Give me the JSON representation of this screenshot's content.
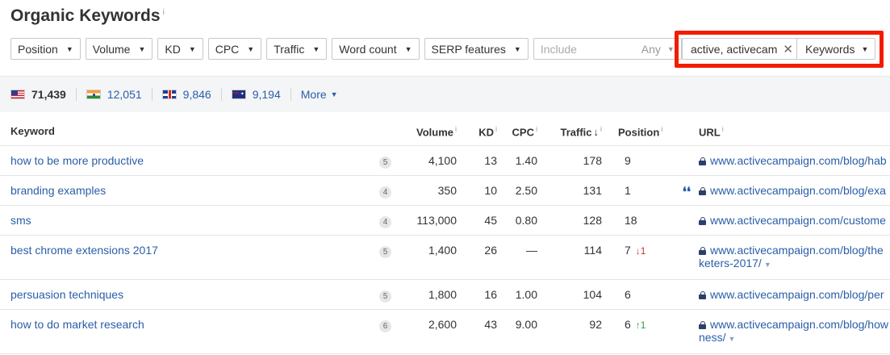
{
  "title": "Organic Keywords",
  "info_mark": "i",
  "filters": [
    {
      "label": "Position"
    },
    {
      "label": "Volume"
    },
    {
      "label": "KD"
    },
    {
      "label": "CPC"
    },
    {
      "label": "Traffic"
    },
    {
      "label": "Word count"
    },
    {
      "label": "SERP features"
    }
  ],
  "include": {
    "placeholder": "Include",
    "any_label": "Any"
  },
  "search": {
    "value": "active, activecam",
    "scope_label": "Keywords"
  },
  "countries": [
    {
      "flag": "us",
      "count": "71,439"
    },
    {
      "flag": "in",
      "count": "12,051"
    },
    {
      "flag": "gb",
      "count": "9,846"
    },
    {
      "flag": "au",
      "count": "9,194"
    }
  ],
  "more_label": "More",
  "columns": {
    "keyword": "Keyword",
    "volume": "Volume",
    "kd": "KD",
    "cpc": "CPC",
    "traffic": "Traffic",
    "position": "Position",
    "url": "URL"
  },
  "rows": [
    {
      "keyword": "how to be more productive",
      "wc": "5",
      "volume": "4,100",
      "kd": "13",
      "cpc": "1.40",
      "traffic": "178",
      "position": "9",
      "change": "",
      "change_dir": "",
      "serp": "",
      "url": "www.activecampaign.com/blog/hab",
      "url2": ""
    },
    {
      "keyword": "branding examples",
      "wc": "4",
      "volume": "350",
      "kd": "10",
      "cpc": "2.50",
      "traffic": "131",
      "position": "1",
      "change": "",
      "change_dir": "",
      "serp": "❛❛",
      "url": "www.activecampaign.com/blog/exa",
      "url2": ""
    },
    {
      "keyword": "sms",
      "wc": "4",
      "volume": "113,000",
      "kd": "45",
      "cpc": "0.80",
      "traffic": "128",
      "position": "18",
      "change": "",
      "change_dir": "",
      "serp": "",
      "url": "www.activecampaign.com/custome",
      "url2": ""
    },
    {
      "keyword": "best chrome extensions 2017",
      "wc": "5",
      "volume": "1,400",
      "kd": "26",
      "cpc": "—",
      "traffic": "114",
      "position": "7",
      "change": "↓1",
      "change_dir": "down",
      "serp": "",
      "url": "www.activecampaign.com/blog/the",
      "url2": "keters-2017/"
    },
    {
      "keyword": "persuasion techniques",
      "wc": "5",
      "volume": "1,800",
      "kd": "16",
      "cpc": "1.00",
      "traffic": "104",
      "position": "6",
      "change": "",
      "change_dir": "",
      "serp": "",
      "url": "www.activecampaign.com/blog/per",
      "url2": ""
    },
    {
      "keyword": "how to do market research",
      "wc": "6",
      "volume": "2,600",
      "kd": "43",
      "cpc": "9.00",
      "traffic": "92",
      "position": "6",
      "change": "↑1",
      "change_dir": "up",
      "serp": "",
      "url": "www.activecampaign.com/blog/how",
      "url2": "ness/"
    }
  ],
  "colors": {
    "link": "#2a5ea8",
    "highlight": "#f41c00",
    "down": "#c0392b",
    "up": "#2e9e3e"
  }
}
